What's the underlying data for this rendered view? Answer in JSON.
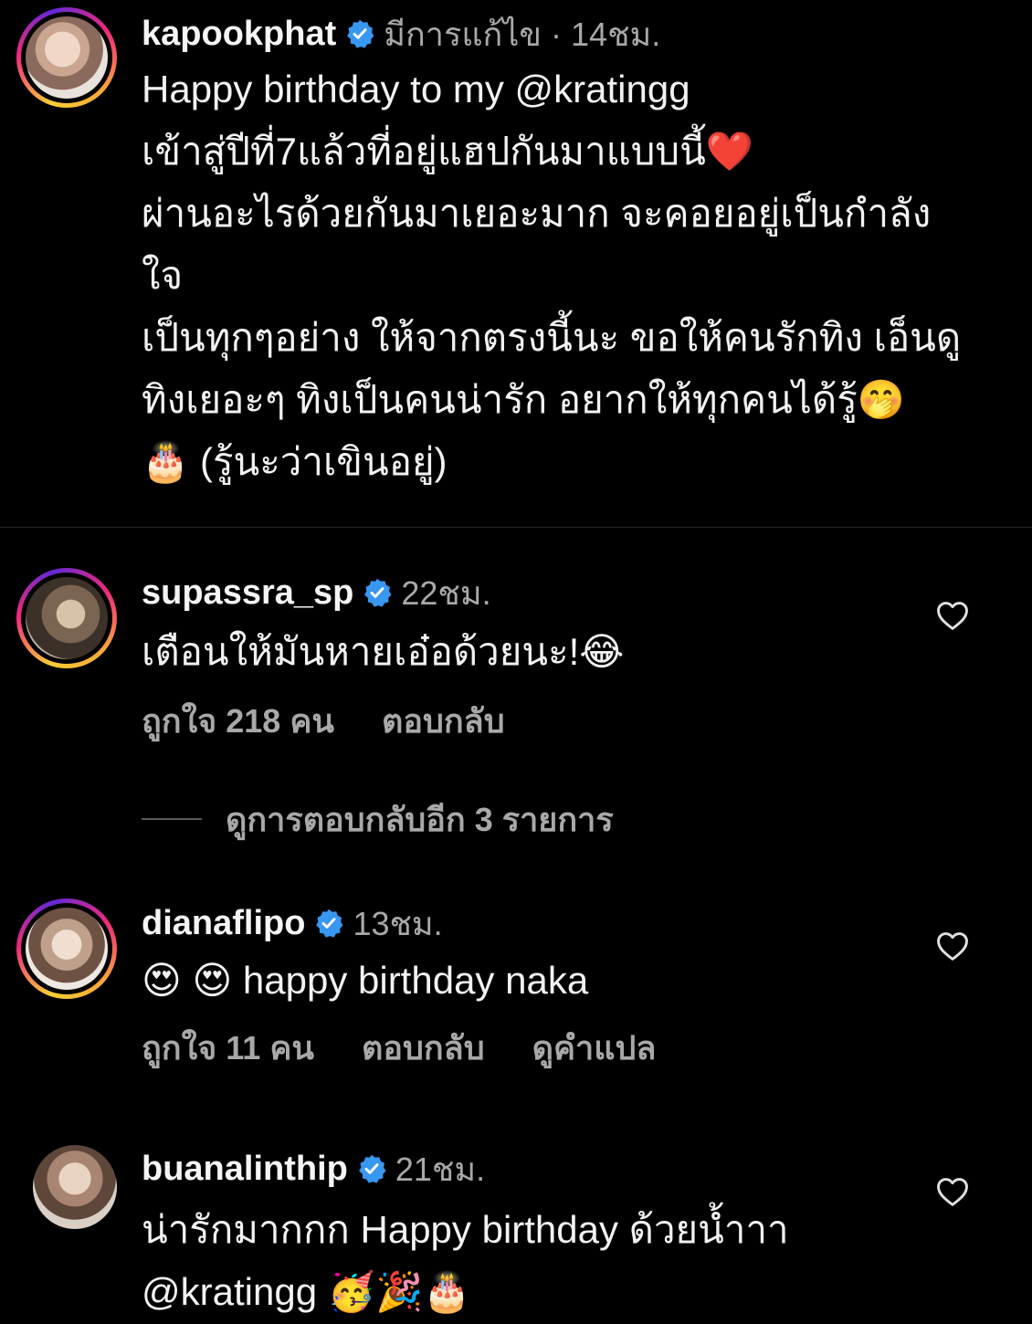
{
  "caption_post": {
    "username": "kapookphat",
    "meta": "มีการแก้ไข · 14ชม.",
    "lines": [
      "Happy birthday to my @kratingg",
      "เข้าสู่ปีที่7แล้วที่อยู่แฮปกันมาแบบนี้❤️",
      "ผ่านอะไรด้วยกันมาเยอะมาก จะคอยอยู่เป็นกำลัง",
      "ใจ",
      "เป็นทุกๆอย่าง ให้จากตรงนี้นะ ขอให้คนรักทิง เอ็นดู",
      "ทิงเยอะๆ ทิงเป็นคนน่ารัก อยากให้ทุกคนได้รู้🤭",
      "🎂 (รู้นะว่าเขินอยู่)"
    ]
  },
  "comments": [
    {
      "username": "supassra_sp",
      "time": "22ชม.",
      "lines": [
        "เตือนให้มันหายเอ๋อด้วยนะ!😂"
      ],
      "likes": "ถูกใจ 218 คน",
      "reply": "ตอบกลับ",
      "view_replies": "ดูการตอบกลับอีก 3 รายการ"
    },
    {
      "username": "dianaflipo",
      "time": "13ชม.",
      "lines": [
        "😍 😍 happy birthday naka"
      ],
      "likes": "ถูกใจ 11 คน",
      "reply": "ตอบกลับ",
      "translate": "ดูคำแปล"
    },
    {
      "username": "buanalinthip",
      "time": "21ชม.",
      "lines": [
        "น่ารักมากกก Happy birthday ด้วยน้ำาา",
        "@kratingg 🥳🎉🎂"
      ]
    }
  ],
  "icons": {
    "verified": "verified-badge-icon",
    "heart": "heart-outline-icon"
  },
  "colors": {
    "verified_blue": "#3897f0",
    "muted_text": "#a8a8a8"
  }
}
